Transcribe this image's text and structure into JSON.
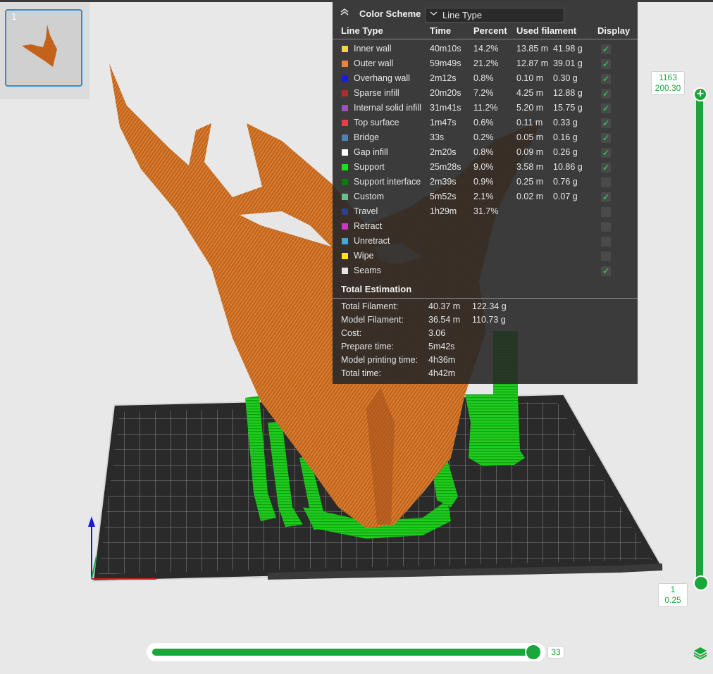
{
  "thumbnail": {
    "index": "1"
  },
  "legend": {
    "color_scheme_label": "Color Scheme",
    "color_scheme_value": "Line Type",
    "headers": {
      "line_type": "Line Type",
      "time": "Time",
      "percent": "Percent",
      "used_filament": "Used filament",
      "display": "Display"
    },
    "rows": [
      {
        "name": "Inner wall",
        "color": "#f5d33a",
        "time": "40m10s",
        "percent": "14.2%",
        "length": "13.85 m",
        "weight": "41.98 g",
        "display": true
      },
      {
        "name": "Outer wall",
        "color": "#f0803a",
        "time": "59m49s",
        "percent": "21.2%",
        "length": "12.87 m",
        "weight": "39.01 g",
        "display": true
      },
      {
        "name": "Overhang wall",
        "color": "#1a1ae6",
        "time": "2m12s",
        "percent": "0.8%",
        "length": "0.10 m",
        "weight": "0.30 g",
        "display": true
      },
      {
        "name": "Sparse infill",
        "color": "#b22a2a",
        "time": "20m20s",
        "percent": "7.2%",
        "length": "4.25 m",
        "weight": "12.88 g",
        "display": true
      },
      {
        "name": "Internal solid infill",
        "color": "#9a4fc4",
        "time": "31m41s",
        "percent": "11.2%",
        "length": "5.20 m",
        "weight": "15.75 g",
        "display": true
      },
      {
        "name": "Top surface",
        "color": "#e84040",
        "time": "1m47s",
        "percent": "0.6%",
        "length": "0.11 m",
        "weight": "0.33 g",
        "display": true
      },
      {
        "name": "Bridge",
        "color": "#4d80b8",
        "time": "33s",
        "percent": "0.2%",
        "length": "0.05 m",
        "weight": "0.16 g",
        "display": true
      },
      {
        "name": "Gap infill",
        "color": "#ffffff",
        "time": "2m20s",
        "percent": "0.8%",
        "length": "0.09 m",
        "weight": "0.26 g",
        "display": true
      },
      {
        "name": "Support",
        "color": "#19e019",
        "time": "25m28s",
        "percent": "9.0%",
        "length": "3.58 m",
        "weight": "10.86 g",
        "display": true
      },
      {
        "name": "Support interface",
        "color": "#0d7a0d",
        "time": "2m39s",
        "percent": "0.9%",
        "length": "0.25 m",
        "weight": "0.76 g",
        "display": false
      },
      {
        "name": "Custom",
        "color": "#5ec48a",
        "time": "5m52s",
        "percent": "2.1%",
        "length": "0.02 m",
        "weight": "0.07 g",
        "display": true
      },
      {
        "name": "Travel",
        "color": "#2a3f9a",
        "time": "1h29m",
        "percent": "31.7%",
        "length": "",
        "weight": "",
        "display": false
      },
      {
        "name": "Retract",
        "color": "#cc33cc",
        "time": "",
        "percent": "",
        "length": "",
        "weight": "",
        "display": false
      },
      {
        "name": "Unretract",
        "color": "#3fa9d9",
        "time": "",
        "percent": "",
        "length": "",
        "weight": "",
        "display": false
      },
      {
        "name": "Wipe",
        "color": "#ffe600",
        "time": "",
        "percent": "",
        "length": "",
        "weight": "",
        "display": false
      },
      {
        "name": "Seams",
        "color": "#e6e6e6",
        "time": "",
        "percent": "",
        "length": "",
        "weight": "",
        "display": true
      }
    ],
    "total_title": "Total Estimation",
    "totals": [
      {
        "label": "Total Filament:",
        "v1": "40.37 m",
        "v2": "122.34 g"
      },
      {
        "label": "Model Filament:",
        "v1": "36.54 m",
        "v2": "110.73 g"
      },
      {
        "label": "Cost:",
        "v1": "3.06",
        "v2": ""
      },
      {
        "label": "Prepare time:",
        "v1": "5m42s",
        "v2": ""
      },
      {
        "label": "Model printing time:",
        "v1": "4h36m",
        "v2": ""
      },
      {
        "label": "Total time:",
        "v1": "4h42m",
        "v2": ""
      }
    ]
  },
  "layer_slider": {
    "top_layer": "1163",
    "top_height": "200.30",
    "bottom_layer": "1",
    "bottom_height": "0.25"
  },
  "move_slider": {
    "value": "33"
  },
  "colors": {
    "accent": "#1aa63a",
    "model": "#c8651e",
    "support": "#1fd11f"
  }
}
